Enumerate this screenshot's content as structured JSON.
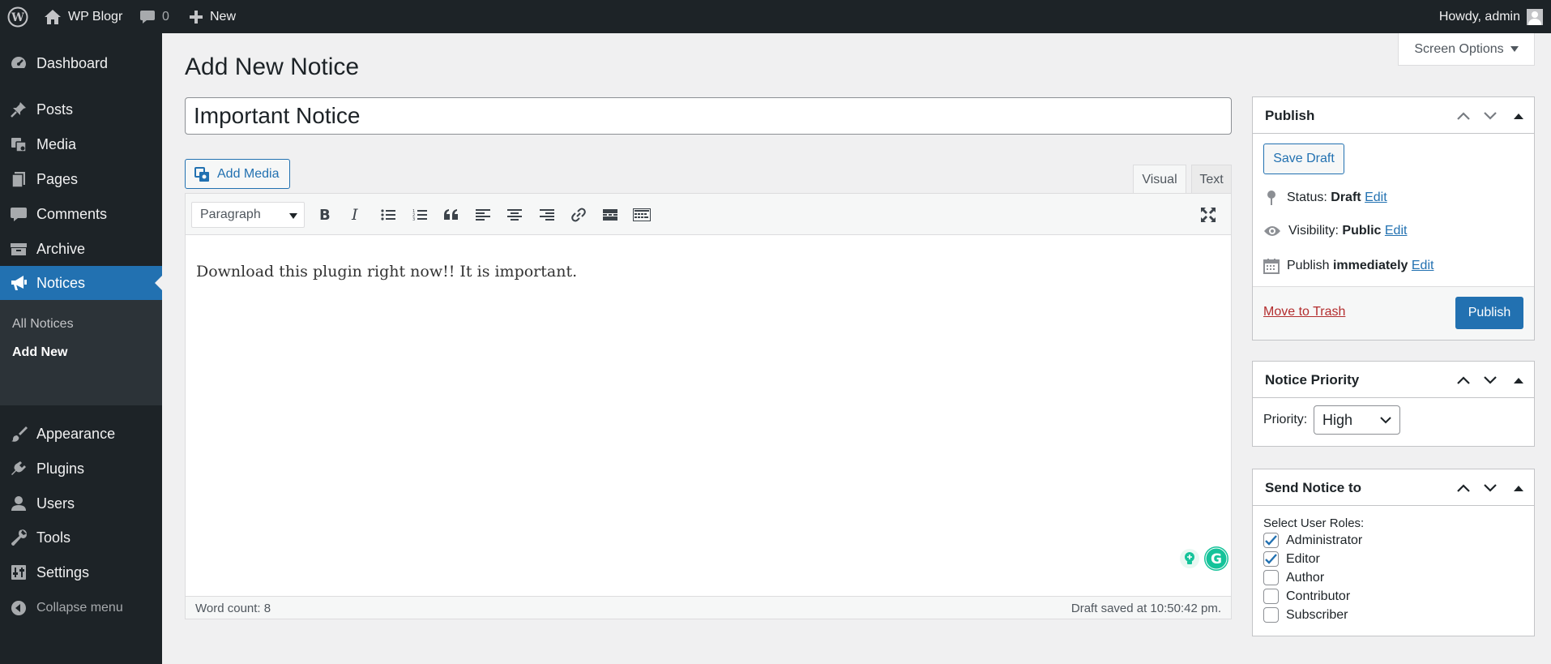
{
  "admin_bar": {
    "site_name": "WP Blogr",
    "comments_count": "0",
    "new_label": "New",
    "howdy": "Howdy, admin"
  },
  "sidebar": {
    "items": [
      {
        "label": "Dashboard",
        "icon": "dashboard-icon"
      },
      {
        "label": "Posts",
        "icon": "pin-icon"
      },
      {
        "label": "Media",
        "icon": "media-icon"
      },
      {
        "label": "Pages",
        "icon": "pages-icon"
      },
      {
        "label": "Comments",
        "icon": "comment-icon"
      },
      {
        "label": "Archive",
        "icon": "archive-icon"
      },
      {
        "label": "Notices",
        "icon": "megaphone-icon",
        "current": true
      },
      {
        "label": "Appearance",
        "icon": "brush-icon"
      },
      {
        "label": "Plugins",
        "icon": "plugin-icon"
      },
      {
        "label": "Users",
        "icon": "users-icon"
      },
      {
        "label": "Tools",
        "icon": "wrench-icon"
      },
      {
        "label": "Settings",
        "icon": "settings-icon"
      }
    ],
    "submenu": [
      "All Notices",
      "Add New"
    ],
    "collapse_label": "Collapse menu"
  },
  "screen_options": "Screen Options",
  "page_title": "Add New Notice",
  "post_title": "Important Notice",
  "editor": {
    "add_media": "Add Media",
    "tab_visual": "Visual",
    "tab_text": "Text",
    "format": "Paragraph",
    "content": "Download this plugin right now!! It is important.",
    "word_count": "Word count: 8",
    "draft_saved": "Draft saved at 10:50:42 pm."
  },
  "publish_box": {
    "title": "Publish",
    "save_draft": "Save Draft",
    "status_label": "Status:",
    "status_value": "Draft",
    "visibility_label": "Visibility:",
    "visibility_value": "Public",
    "publish_label": "Publish",
    "publish_value": "immediately",
    "edit": "Edit",
    "move_to_trash": "Move to Trash",
    "publish_button": "Publish"
  },
  "priority_box": {
    "title": "Notice Priority",
    "label": "Priority:",
    "value": "High"
  },
  "send_box": {
    "title": "Send Notice to",
    "label": "Select User Roles:",
    "roles": [
      {
        "label": "Administrator",
        "checked": true
      },
      {
        "label": "Editor",
        "checked": true
      },
      {
        "label": "Author",
        "checked": false
      },
      {
        "label": "Contributor",
        "checked": false
      },
      {
        "label": "Subscriber",
        "checked": false
      }
    ]
  },
  "colors": {
    "admin_dark": "#1d2327",
    "accent": "#2271b1",
    "trash": "#b32d2e",
    "grammarly": "#15c39a"
  }
}
